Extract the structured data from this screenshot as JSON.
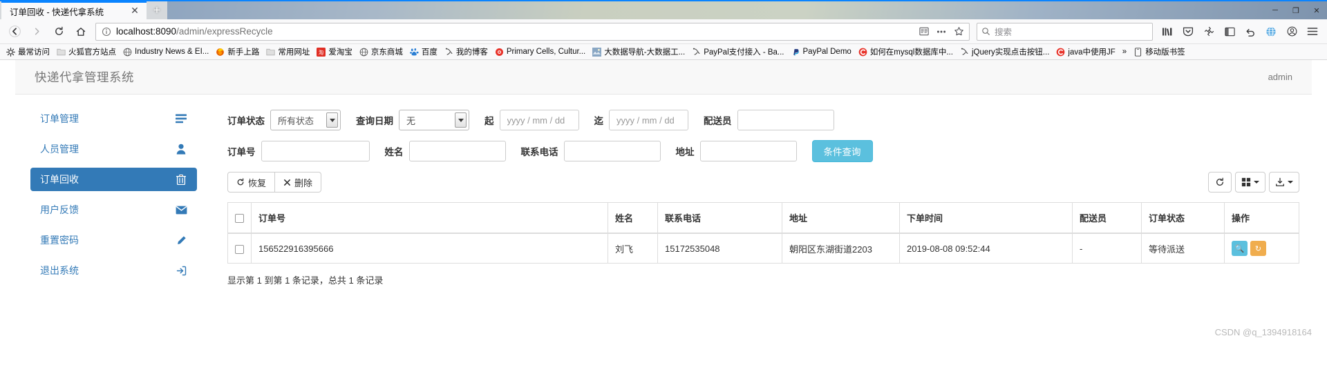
{
  "browser": {
    "tab": {
      "title": "订单回收 - 快递代拿系统",
      "close_label": "✕"
    },
    "newtab_label": "+",
    "window_buttons": {
      "minimize": "─",
      "maximize": "❐",
      "close": "✕"
    },
    "nav": {
      "back": "back-arrow",
      "forward": "forward-arrow",
      "reload": "reload-arrow",
      "home": "home-house"
    },
    "url": {
      "host": "localhost:8090",
      "path": "/admin/expressRecycle"
    },
    "search": {
      "placeholder": "搜索"
    },
    "bookmarks": [
      {
        "label": "最常访问",
        "icon": "star-gear"
      },
      {
        "label": "火狐官方站点",
        "icon": "folder"
      },
      {
        "label": "Industry News & EI...",
        "icon": "globe"
      },
      {
        "label": "新手上路",
        "icon": "firefox"
      },
      {
        "label": "常用网址",
        "icon": "folder"
      },
      {
        "label": "爱淘宝",
        "icon": "taobao"
      },
      {
        "label": "京东商城",
        "icon": "globe"
      },
      {
        "label": "百度",
        "icon": "baidu"
      },
      {
        "label": "我的博客",
        "icon": "bookmark-generic"
      },
      {
        "label": "Primary Cells, Cultur...",
        "icon": "red-circle"
      },
      {
        "label": "大数据导航-大数据工...",
        "icon": "image-tile"
      },
      {
        "label": "PayPal支付接入 - Ba...",
        "icon": "bookmark-generic"
      },
      {
        "label": "PayPal Demo",
        "icon": "paypal"
      },
      {
        "label": "如何在mysql数据库中...",
        "icon": "csdn"
      },
      {
        "label": "jQuery实现点击按钮...",
        "icon": "bookmark-generic"
      },
      {
        "label": "java中使用JF",
        "icon": "csdn"
      },
      {
        "label": "»",
        "icon": "overflow-chevron"
      },
      {
        "label": "移动版书签",
        "icon": "mobile-bookmarks"
      }
    ]
  },
  "app": {
    "brand": "快递代拿管理系统",
    "user": "admin",
    "sidebar": [
      {
        "label": "订单管理",
        "icon": "list-icon",
        "active": false
      },
      {
        "label": "人员管理",
        "icon": "user-icon",
        "active": false
      },
      {
        "label": "订单回收",
        "icon": "trash-icon",
        "active": true
      },
      {
        "label": "用户反馈",
        "icon": "envelope-icon",
        "active": false
      },
      {
        "label": "重置密码",
        "icon": "pencil-icon",
        "active": false
      },
      {
        "label": "退出系统",
        "icon": "signout-icon",
        "active": false
      }
    ],
    "filters": {
      "status_label": "订单状态",
      "status_value": "所有状态",
      "date_label": "查询日期",
      "date_value": "无",
      "from_label": "起",
      "from_placeholder": "yyyy / mm / dd",
      "from_value": "",
      "to_label": "迄",
      "to_placeholder": "yyyy / mm / dd",
      "to_value": "",
      "rider_label": "配送员",
      "rider_value": "",
      "order_label": "订单号",
      "order_value": "",
      "name_label": "姓名",
      "name_value": "",
      "phone_label": "联系电话",
      "phone_value": "",
      "address_label": "地址",
      "address_value": "",
      "submit_label": "条件查询"
    },
    "toolbar": {
      "restore_label": "恢复",
      "delete_label": "删除",
      "refresh_icon": "refresh-icon",
      "columns_icon": "grid-columns-icon",
      "export_icon": "export-icon"
    },
    "table": {
      "columns": [
        "订单号",
        "姓名",
        "联系电话",
        "地址",
        "下单时间",
        "配送员",
        "订单状态",
        "操作"
      ],
      "rows": [
        {
          "order_no": "156522916395666",
          "name": "刘飞",
          "phone": "15172535048",
          "address": "朝阳区东湖街道2203",
          "order_time": "2019-08-08 09:52:44",
          "rider": "-",
          "status": "等待派送",
          "actions": [
            {
              "name": "view",
              "glyph": "🔍"
            },
            {
              "name": "restore",
              "glyph": "↻"
            },
            {
              "name": "delete",
              "glyph": "✕"
            }
          ]
        }
      ],
      "footer": "显示第 1 到第 1 条记录，总共 1 条记录"
    }
  },
  "watermark": "CSDN @q_1394918164",
  "colors": {
    "accent": "#337ab7",
    "info": "#5bc0de",
    "warning": "#f0ad4e",
    "danger": "#d9534f",
    "browser_accent": "#0a84ff"
  }
}
